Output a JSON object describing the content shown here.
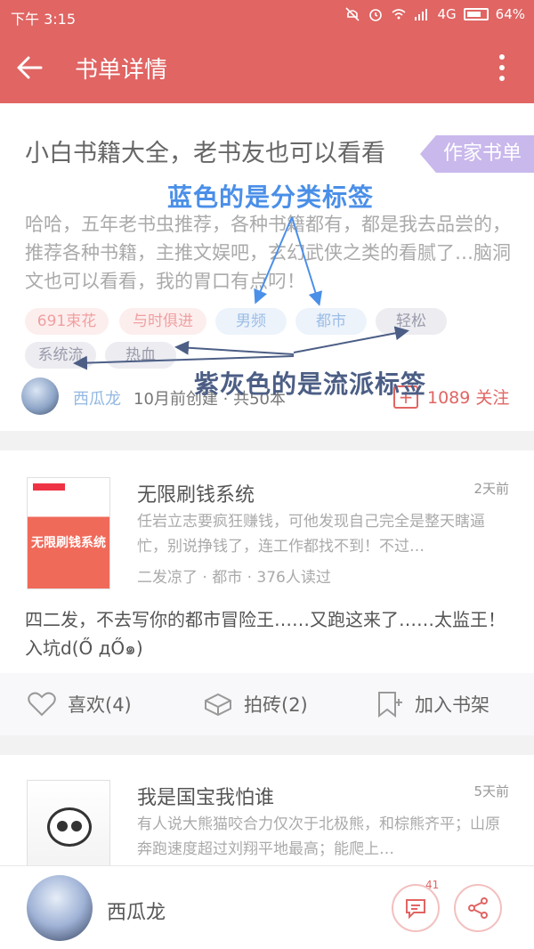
{
  "status_bar": {
    "time": "下午 3:15",
    "network": "4G",
    "battery": "64%"
  },
  "app_bar": {
    "title": "书单详情"
  },
  "booklist": {
    "badge": "作家书单",
    "title": "小白书籍大全，老书友也可以看看",
    "description": "哈哈，五年老书虫推荐，各种书籍都有，都是我去品尝的，推荐各种书籍，主推文娱吧，玄幻武侠之类的看腻了…脑洞文也可以看看，我的胃口有点叼！",
    "tags": [
      "691束花",
      "与时俱进",
      "男频",
      "都市",
      "轻松",
      "系统流",
      "热血"
    ],
    "author": "西瓜龙",
    "meta": "10月前创建 · 共50本",
    "follow_count": "1089 关注"
  },
  "annotations": {
    "blue_note": "蓝色的是分类标签",
    "purple_note": "紫灰色的是流派标签"
  },
  "books": [
    {
      "title": "无限刷钱系统",
      "time": "2天前",
      "description": "任岩立志要疯狂赚钱，可他发现自己完全是整天瞎逼忙，别说挣钱了，连工作都找不到！不过…",
      "meta": "二发凉了 · 都市 · 376人读过",
      "cover_text": "无限刷钱系统",
      "comment": "四二发，不去写你的都市冒险王……又跑这来了……太监王！入坑d(Ő дŐ๑)"
    },
    {
      "title": "我是国宝我怕谁",
      "time": "5天前",
      "description": "有人说大熊猫咬合力仅次于北极熊，和棕熊齐平；山原奔跑速度超过刘翔平地最高；能爬上…"
    }
  ],
  "actions": {
    "like": "喜欢(4)",
    "brick": "拍砖(2)",
    "shelf": "加入书架"
  },
  "bottom": {
    "name": "西瓜龙",
    "comment_count": "41"
  },
  "icons": {
    "back": "back-arrow-icon",
    "more": "more-vertical-icon",
    "heart": "heart-icon",
    "brick": "brick-icon",
    "bookmark": "bookmark-add-icon",
    "comment": "comment-icon",
    "share": "share-icon"
  },
  "colors": {
    "brand": "#e06563",
    "blue_tag": "#9bbde6",
    "pink_tag": "#f0a0a0",
    "gray_tag": "#9a9aab",
    "annotation_blue": "#4a8fe8",
    "annotation_purple": "#4c5e85"
  }
}
